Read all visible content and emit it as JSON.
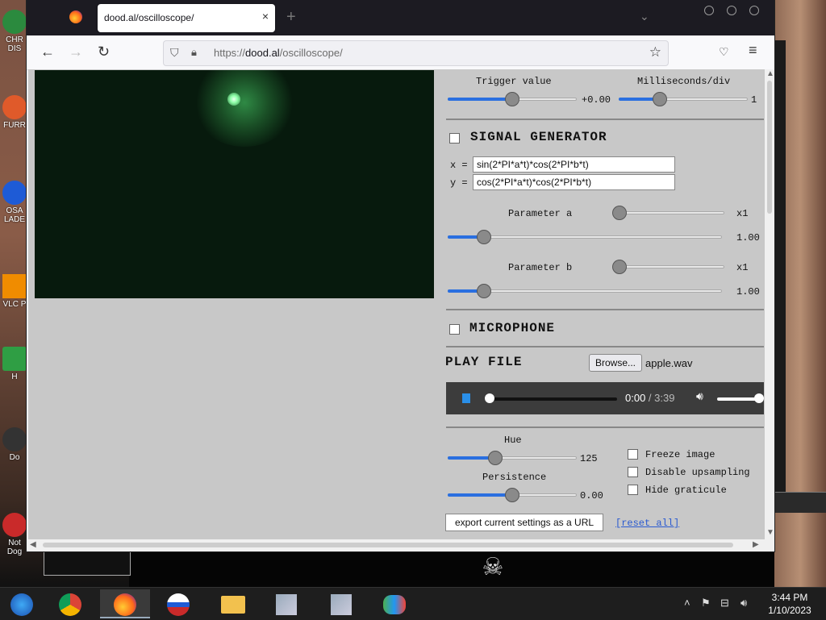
{
  "desktop": {
    "icons": [
      {
        "label": "CHR DIS",
        "color": "#2b8a3e"
      },
      {
        "label": "FURR",
        "color": "#e05a2a"
      },
      {
        "label": "OSA LADE",
        "color": "#1e5bd6"
      },
      {
        "label": "VLC P",
        "color": "#f08c00"
      },
      {
        "label": "H",
        "color": "#2f9e44"
      },
      {
        "label": "Do",
        "color": "#333333"
      },
      {
        "label": "Not Dog",
        "color": "#c92a2a"
      }
    ]
  },
  "browser": {
    "tab_title": "dood.al/oscilloscope/",
    "tab_close": "×",
    "new_tab": "+",
    "url_prefix": "https://",
    "url_domain": "dood.al",
    "url_path": "/oscilloscope/"
  },
  "controls": {
    "trigger_label": "Trigger value",
    "trigger_value": "+0.00",
    "trigger_level": 0.5,
    "ms_label": "Milliseconds/div",
    "ms_value": "1",
    "ms_level": 0.32,
    "signal_generator_label": "SIGNAL GENERATOR",
    "x_label": "x =",
    "x_expr": "sin(2*PI*a*t)*cos(2*PI*b*t)",
    "y_label": "y =",
    "y_expr": "cos(2*PI*a*t)*cos(2*PI*b*t)",
    "param_a_label": "Parameter a",
    "param_a_mult": "x1",
    "param_a_value": "1.00",
    "param_b_label": "Parameter b",
    "param_b_mult": "x1",
    "param_b_value": "1.00",
    "microphone_label": "MICROPHONE",
    "play_file_label": "PLAY FILE",
    "browse_label": "Browse...",
    "file_name": "apple.wav",
    "audio_current": "0:00",
    "audio_sep": " / ",
    "audio_duration": "3:39",
    "hue_label": "Hue",
    "hue_value": "125",
    "persistence_label": "Persistence",
    "persistence_value": "0.00",
    "freeze_label": "Freeze image",
    "upsampling_label": "Disable upsampling",
    "graticule_label": "Hide graticule",
    "export_label": "export current settings as a URL",
    "reset_label": "[reset all]"
  },
  "taskbar": {
    "time": "3:44 PM",
    "date": "1/10/2023"
  },
  "colors": {
    "accent": "#2a6fe0",
    "scope_bg": "#071a0d",
    "trace": "#8effa8"
  }
}
